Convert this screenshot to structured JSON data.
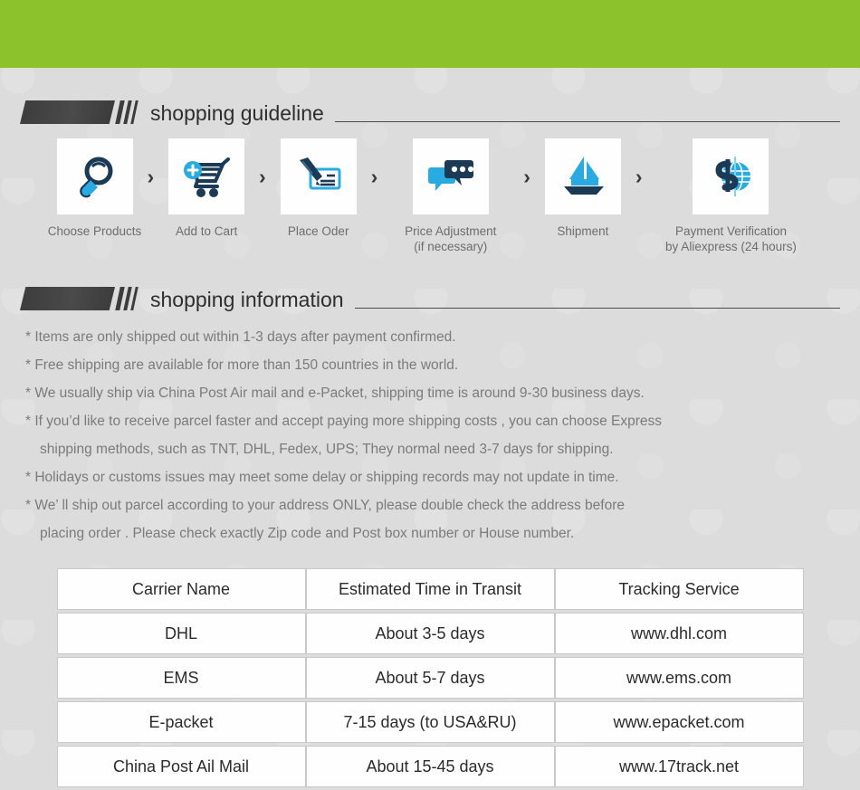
{
  "theme": {
    "banner_color": "#8cc22b",
    "page_background": "#dcdcdc",
    "icon_dark": "#1b3a55",
    "icon_light": "#29abe2"
  },
  "banner": {
    "name": "top-green-banner"
  },
  "guideline": {
    "title": "shopping guideline",
    "steps": [
      {
        "label": "Choose Products",
        "label2": "",
        "icon": "magnifier-icon"
      },
      {
        "label": "Add to Cart",
        "label2": "",
        "icon": "cart-plus-icon"
      },
      {
        "label": "Place Oder",
        "label2": "",
        "icon": "pen-check-icon"
      },
      {
        "label": "Price Adjustment",
        "label2": "(if necessary)",
        "icon": "chat-bubbles-icon"
      },
      {
        "label": "Shipment",
        "label2": "",
        "icon": "sailboat-icon"
      },
      {
        "label": "Payment Verification",
        "label2": "by  Aliexpress (24 hours)",
        "icon": "globe-dollar-icon"
      }
    ],
    "separator": "›"
  },
  "information": {
    "title": "shopping information",
    "lines": [
      {
        "text": "* Items are only shipped out within 1-3 days after payment confirmed.",
        "indent": false
      },
      {
        "text": "* Free shipping are available for more than 150 countries in the world.",
        "indent": false
      },
      {
        "text": "* We usually ship via China Post Air mail and e-Packet, shipping time is around 9-30 business days.",
        "indent": false
      },
      {
        "text": "* If you’d like to receive parcel faster and accept paying more shipping costs , you can choose Express",
        "indent": false
      },
      {
        "text": "shipping methods, such as TNT, DHL, Fedex, UPS; They normal need 3-7 days for shipping.",
        "indent": true
      },
      {
        "text": "* Holidays or customs issues may meet some delay or shipping records may not update in time.",
        "indent": false
      },
      {
        "text": "* We’ ll ship out parcel according to your address ONLY, please double check the address before",
        "indent": false
      },
      {
        "text": "placing order . Please check exactly Zip code and Post box number or House number.",
        "indent": true
      }
    ]
  },
  "carrier_table": {
    "headers": [
      "Carrier Name",
      "Estimated Time in Transit",
      "Tracking Service"
    ],
    "rows": [
      [
        "DHL",
        "About 3-5 days",
        "www.dhl.com"
      ],
      [
        "EMS",
        "About 5-7 days",
        "www.ems.com"
      ],
      [
        "E-packet",
        "7-15 days (to USA&RU)",
        "www.epacket.com"
      ],
      [
        "China Post Ail Mail",
        "About 15-45 days",
        "www.17track.net"
      ]
    ]
  }
}
